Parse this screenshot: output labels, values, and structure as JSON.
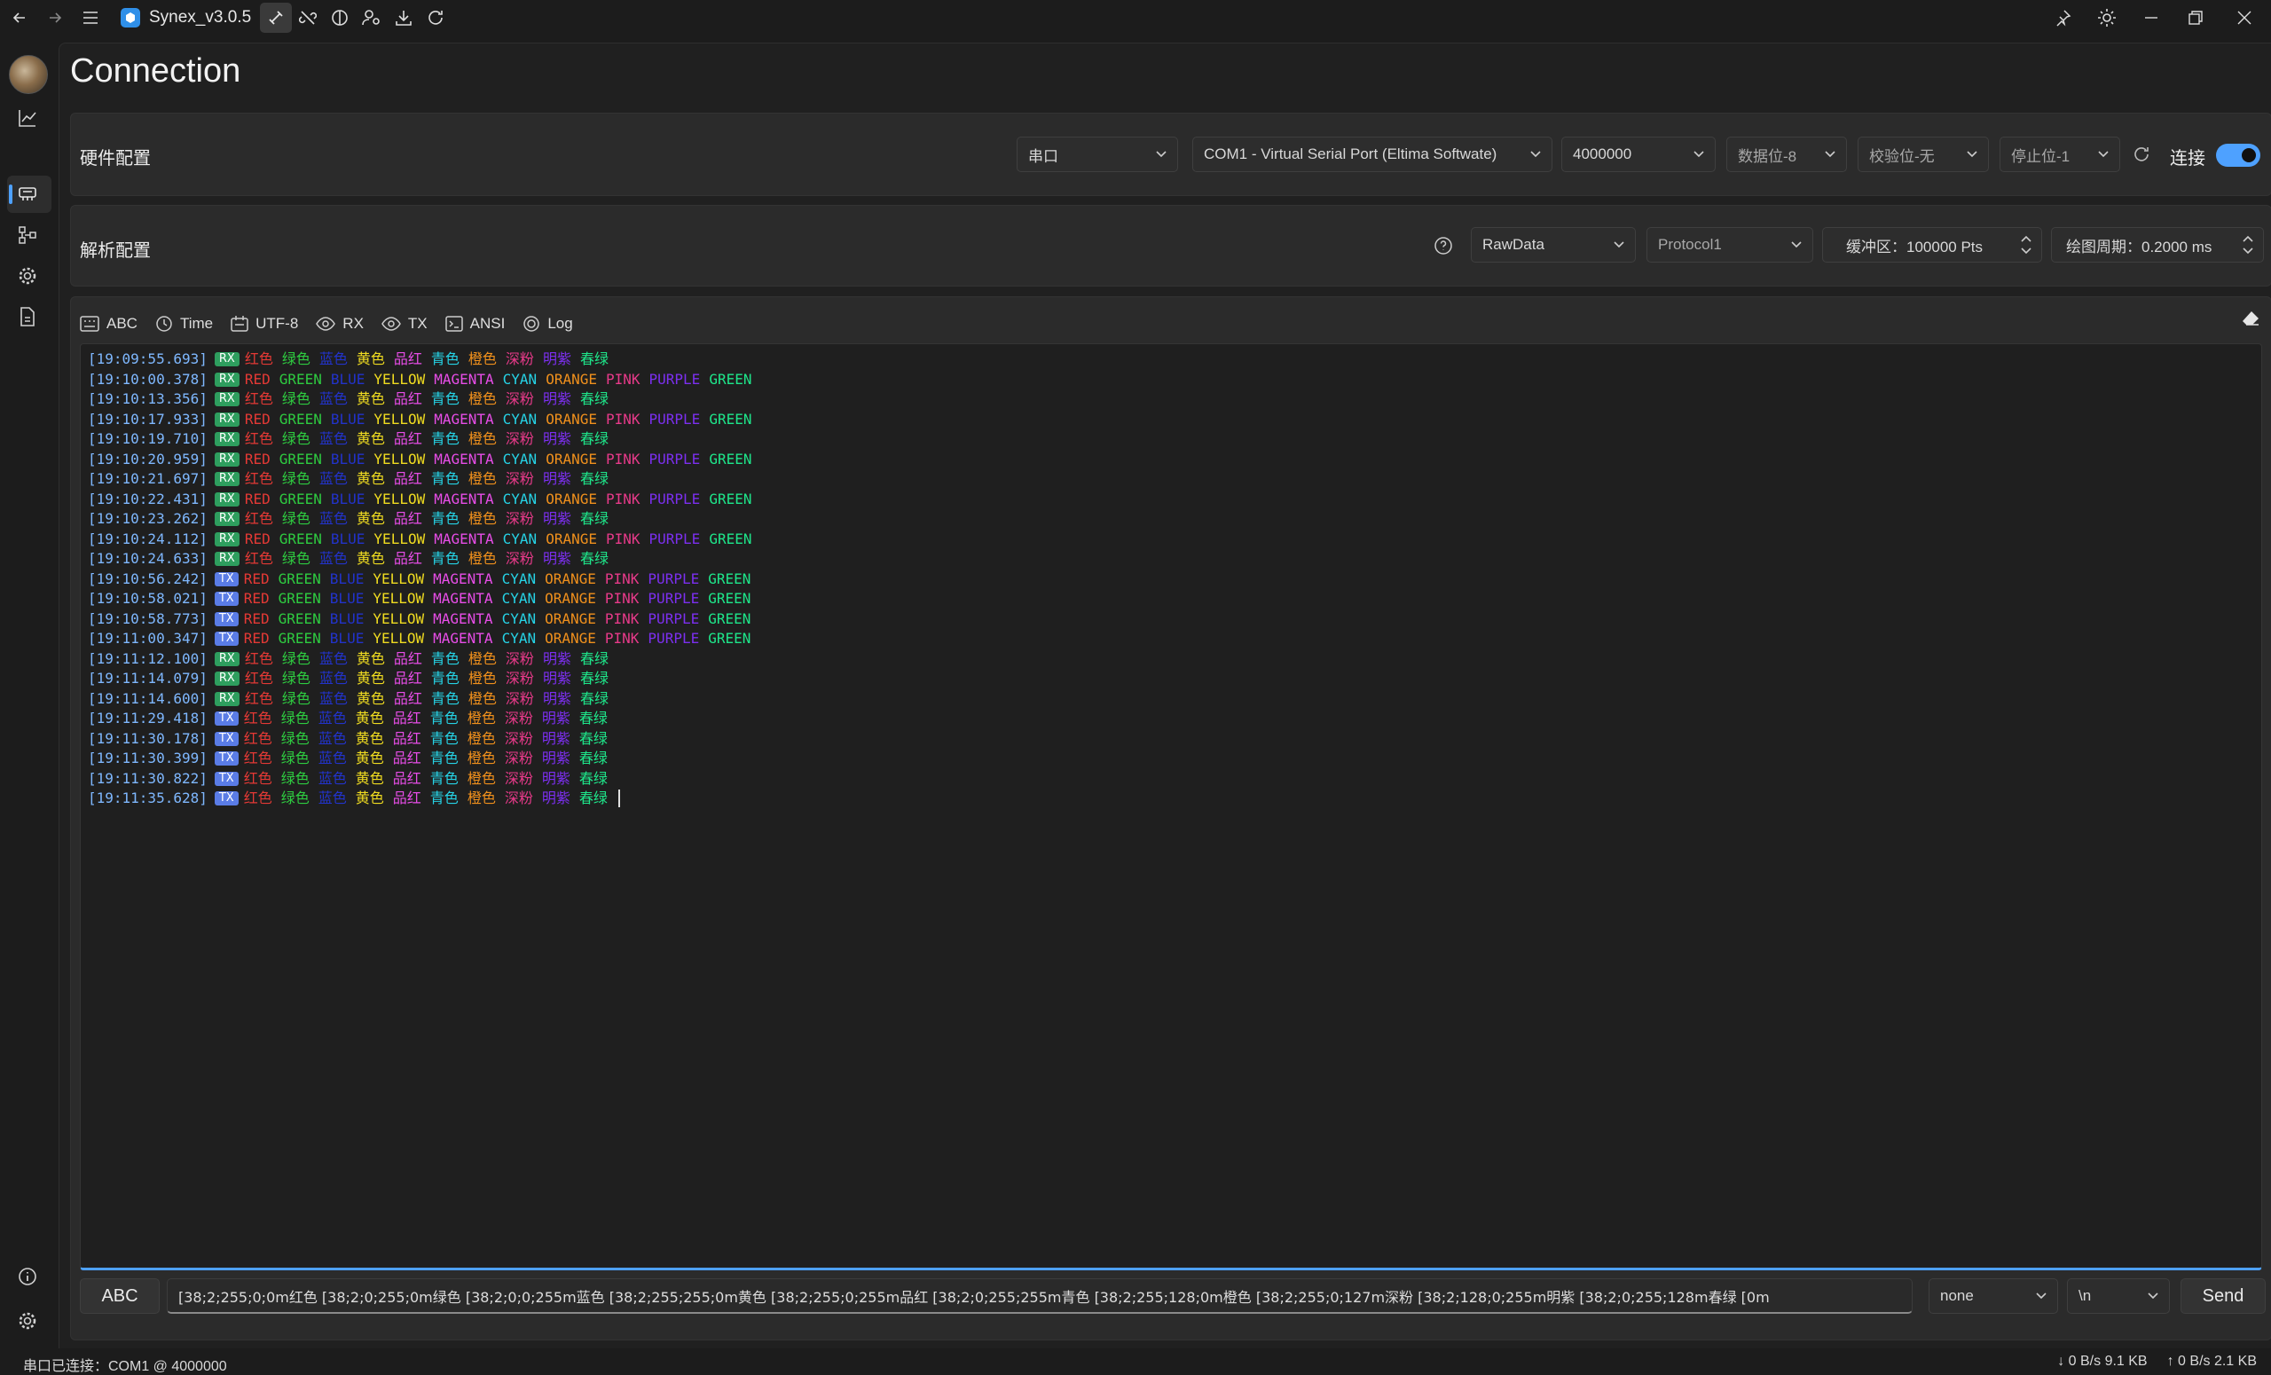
{
  "titlebar": {
    "app_title": "Synex_v3.0.5",
    "tools": [
      "plugin-icon",
      "unlink-icon",
      "theme-half-icon",
      "user-settings-icon",
      "download-icon",
      "refresh-icon"
    ]
  },
  "page": {
    "title": "Connection"
  },
  "hardware": {
    "title": "硬件配置",
    "interface": "串口",
    "port": "COM1 - Virtual Serial Port (Eltima Softwate)",
    "baud": "4000000",
    "databits": "数据位-8",
    "parity": "校验位-无",
    "stopbits": "停止位-1",
    "connect_label": "连接",
    "connected": true
  },
  "parse": {
    "title": "解析配置",
    "mode": "RawData",
    "protocol": "Protocol1",
    "buffer": "缓冲区：100000 Pts",
    "plot_period": "绘图周期：0.2000 ms"
  },
  "toolbar": {
    "abc": "ABC",
    "time": "Time",
    "encoding": "UTF-8",
    "rx": "RX",
    "tx": "TX",
    "ansi": "ANSI",
    "log": "Log"
  },
  "colors": {
    "accent": "#4ea1ff",
    "rx_badge": "#2e9e5e",
    "tx_badge": "#5a7ce6",
    "red": "#e53935",
    "green": "#2ecc40",
    "blue": "#2233cc",
    "yellow": "#f0dc20",
    "magenta": "#e84de8",
    "cyan": "#26d3e6",
    "orange": "#f0901c",
    "pink": "#e83a8a",
    "purple": "#7c2ff0",
    "spring": "#1ee68a"
  },
  "terminal": {
    "cn_words": [
      "红色",
      "绿色",
      "蓝色",
      "黄色",
      "品红",
      "青色",
      "橙色",
      "深粉",
      "明紫",
      "春绿"
    ],
    "en_words": [
      "RED",
      "GREEN",
      "BLUE",
      "YELLOW",
      "MAGENTA",
      "CYAN",
      "ORANGE",
      "PINK",
      "PURPLE",
      "GREEN"
    ],
    "word_colors": [
      "red",
      "green",
      "blue",
      "yellow",
      "magenta",
      "cyan",
      "orange",
      "pink",
      "purple",
      "spring"
    ],
    "lines": [
      {
        "ts": "[19:09:55.693]",
        "dir": "RX",
        "set": "cn"
      },
      {
        "ts": "[19:10:00.378]",
        "dir": "RX",
        "set": "en"
      },
      {
        "ts": "[19:10:13.356]",
        "dir": "RX",
        "set": "cn"
      },
      {
        "ts": "[19:10:17.933]",
        "dir": "RX",
        "set": "en"
      },
      {
        "ts": "[19:10:19.710]",
        "dir": "RX",
        "set": "cn"
      },
      {
        "ts": "[19:10:20.959]",
        "dir": "RX",
        "set": "en"
      },
      {
        "ts": "[19:10:21.697]",
        "dir": "RX",
        "set": "cn"
      },
      {
        "ts": "[19:10:22.431]",
        "dir": "RX",
        "set": "en"
      },
      {
        "ts": "[19:10:23.262]",
        "dir": "RX",
        "set": "cn"
      },
      {
        "ts": "[19:10:24.112]",
        "dir": "RX",
        "set": "en"
      },
      {
        "ts": "[19:10:24.633]",
        "dir": "RX",
        "set": "cn"
      },
      {
        "ts": "[19:10:56.242]",
        "dir": "TX",
        "set": "en"
      },
      {
        "ts": "[19:10:58.021]",
        "dir": "TX",
        "set": "en"
      },
      {
        "ts": "[19:10:58.773]",
        "dir": "TX",
        "set": "en"
      },
      {
        "ts": "[19:11:00.347]",
        "dir": "TX",
        "set": "en"
      },
      {
        "ts": "[19:11:12.100]",
        "dir": "RX",
        "set": "cn"
      },
      {
        "ts": "[19:11:14.079]",
        "dir": "RX",
        "set": "cn"
      },
      {
        "ts": "[19:11:14.600]",
        "dir": "RX",
        "set": "cn"
      },
      {
        "ts": "[19:11:29.418]",
        "dir": "TX",
        "set": "cn"
      },
      {
        "ts": "[19:11:30.178]",
        "dir": "TX",
        "set": "cn"
      },
      {
        "ts": "[19:11:30.399]",
        "dir": "TX",
        "set": "cn"
      },
      {
        "ts": "[19:11:30.822]",
        "dir": "TX",
        "set": "cn"
      },
      {
        "ts": "[19:11:35.628]",
        "dir": "TX",
        "set": "cn"
      }
    ]
  },
  "send": {
    "mode_label": "ABC",
    "input_value": "[38;2;255;0;0m红色 [38;2;0;255;0m绿色 [38;2;0;0;255m蓝色 [38;2;255;255;0m黄色 [38;2;255;0;255m品红 [38;2;0;255;255m青色 [38;2;255;128;0m橙色 [38;2;255;0;127m深粉 [38;2;128;0;255m明紫 [38;2;0;255;128m春绿 [0m",
    "checksum": "none",
    "line_ending": "\\n",
    "send_label": "Send"
  },
  "status": {
    "connection": "串口已连接：COM1 @ 4000000",
    "rx_rate": "↓ 0 B/s 9.1 KB",
    "tx_rate": "↑ 0 B/s 2.1 KB"
  }
}
